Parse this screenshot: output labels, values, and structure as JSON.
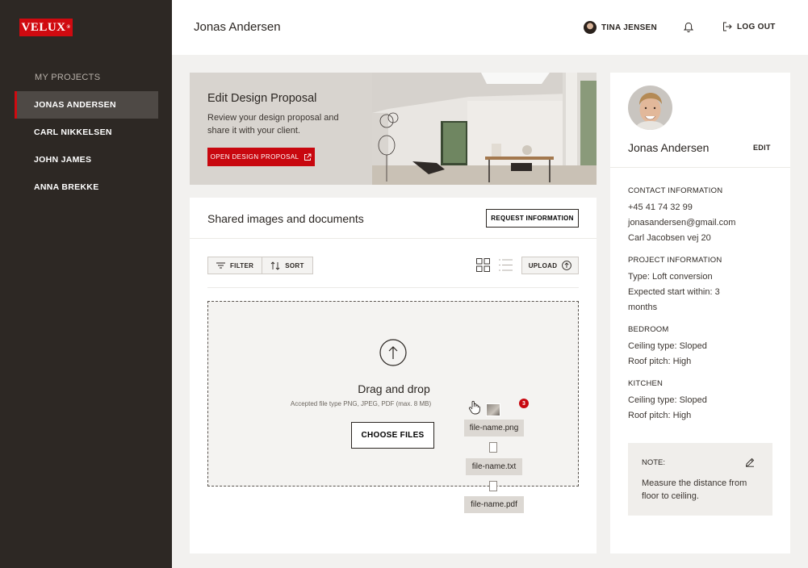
{
  "brand": {
    "logo": "VELUX",
    "mark": "®"
  },
  "sidebar": {
    "heading": "MY PROJECTS",
    "items": [
      {
        "label": "JONAS ANDERSEN",
        "active": true
      },
      {
        "label": "CARL NIKKELSEN",
        "active": false
      },
      {
        "label": "JOHN JAMES",
        "active": false
      },
      {
        "label": "ANNA BREKKE",
        "active": false
      }
    ]
  },
  "header": {
    "title": "Jonas Andersen",
    "user_name": "TINA JENSEN",
    "logout_label": "LOG OUT"
  },
  "hero": {
    "title": "Edit Design Proposal",
    "description": "Review your design proposal and share it with your client.",
    "button_label": "OPEN DESIGN PROPOSAL"
  },
  "docs": {
    "title": "Shared images and documents",
    "request_label": "REQUEST INFORMATION",
    "filter_label": "FILTER",
    "sort_label": "SORT",
    "upload_label": "UPLOAD",
    "dropzone": {
      "title": "Drag and drop",
      "subtitle": "Accepted file type PNG, JPEG, PDF (max. 8 MB)",
      "choose_label": "CHOOSE FILES"
    },
    "drag_count": "3",
    "files": [
      "file-name.png",
      "file-name.txt",
      "file-name.pdf"
    ]
  },
  "profile": {
    "name": "Jonas Andersen",
    "edit_label": "EDIT",
    "contact": {
      "heading": "CONTACT INFORMATION",
      "phone": "+45 41 74 32 99",
      "email": "jonasandersen@gmail.com",
      "address": "Carl Jacobsen vej 20"
    },
    "project": {
      "heading": "PROJECT INFORMATION",
      "type": "Type: Loft conversion",
      "start": "Expected start within: 3 months"
    },
    "bedroom": {
      "heading": "BEDROOM",
      "ceiling": "Ceiling type: Sloped",
      "pitch": "Roof pitch: High"
    },
    "kitchen": {
      "heading": "KITCHEN",
      "ceiling": "Ceiling type: Sloped",
      "pitch": "Roof pitch: High"
    },
    "note": {
      "heading": "NOTE:",
      "text": "Measure the distance from floor to ceiling."
    }
  },
  "colors": {
    "accent": "#c8070f",
    "sidebar": "#2d2824",
    "background": "#f2f1ef"
  }
}
